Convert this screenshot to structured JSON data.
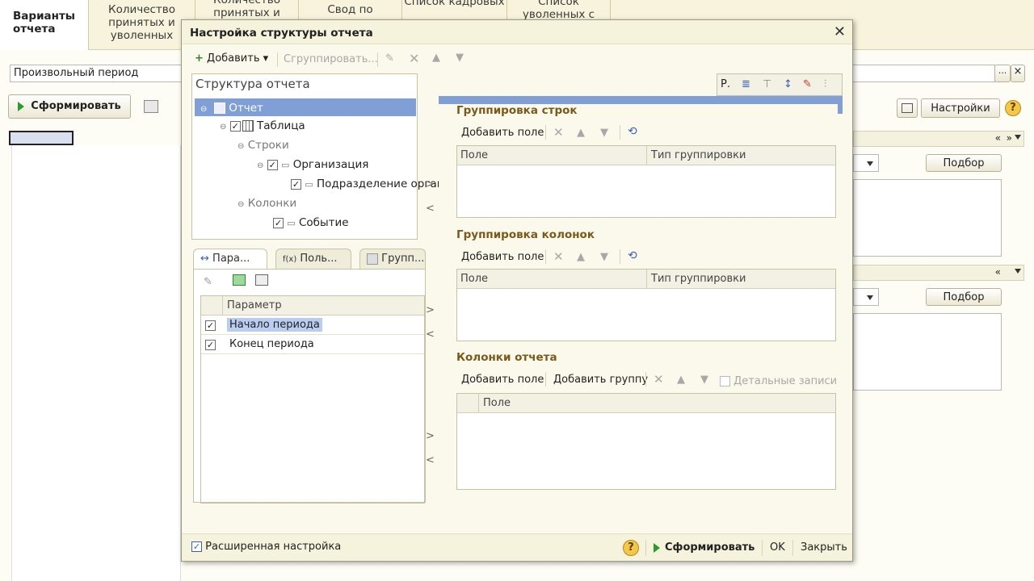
{
  "tabs": [
    {
      "label": "Варианты отчета"
    },
    {
      "label": "Количество принятых и уволенных"
    },
    {
      "label": "Количество принятых и"
    },
    {
      "label": "Свод по"
    },
    {
      "label": "Список кадровых"
    },
    {
      "label": "Список уволенных с"
    }
  ],
  "background": {
    "period_value": "Произвольный период",
    "period_button": "...",
    "clear_button": "×",
    "generate_label": "Сформировать",
    "settings_label": "Настройки",
    "help_label": "?",
    "pick_label_1": "Подбор",
    "pick_label_2": "Подбор",
    "expand_glyph": "«",
    "collapse_glyph": "»"
  },
  "dialog": {
    "title": "Настройка структуры отчета",
    "toolbar": {
      "add": "Добавить",
      "group": "Сгруппировать..."
    },
    "structure_header": "Структура отчета",
    "structure_col_r": "Р.",
    "tree": {
      "report": "Отчет",
      "table": "Таблица",
      "rows": "Строки",
      "org": "Организация",
      "subdivision": "Подразделение организ",
      "columns": "Колонки",
      "event": "Событие"
    },
    "subtabs": [
      "Пара...",
      "Поль...",
      "Групп..."
    ],
    "param_grid": {
      "header": "Параметр",
      "rows": [
        "Начало периода",
        "Конец периода"
      ]
    },
    "row_grouping": {
      "title": "Группировка строк",
      "add_field": "Добавить поле",
      "col_field": "Поле",
      "col_type": "Тип группировки"
    },
    "col_grouping": {
      "title": "Группировка колонок",
      "add_field": "Добавить поле",
      "col_field": "Поле",
      "col_type": "Тип группировки"
    },
    "report_columns": {
      "title": "Колонки отчета",
      "add_field": "Добавить поле",
      "add_group": "Добавить группу",
      "detail_records": "Детальные записи",
      "col_field": "Поле"
    },
    "arrows": {
      "right": ">",
      "left": "<"
    },
    "footer": {
      "extended": "Расширенная настройка",
      "help": "?",
      "generate": "Сформировать",
      "ok": "OK",
      "close": "Закрыть"
    }
  }
}
